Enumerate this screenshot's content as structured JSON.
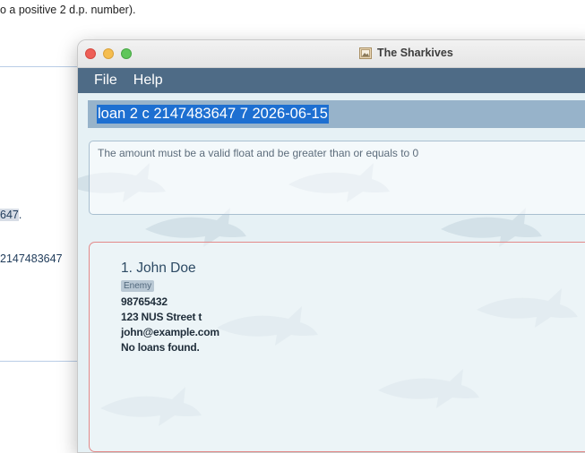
{
  "background_doc": {
    "top_text": "o a positive 2 d.p. number).",
    "fragment_1": "647",
    "fragment_1_suffix": ".",
    "fragment_2": "2147483647"
  },
  "window": {
    "title": "The Sharkives",
    "menu": [
      "File",
      "Help"
    ]
  },
  "command": {
    "value": "loan 2 c 2147483647 7 2026-06-15"
  },
  "result": {
    "message": "The amount must be a valid float and be greater than or equals to 0"
  },
  "person_card": {
    "index_name": "1.  John Doe",
    "tag": "Enemy",
    "phone": "98765432",
    "address": "123 NUS Street t",
    "email": "john@example.com",
    "loans": "No loans found."
  },
  "colors": {
    "menubar": "#4e6b86",
    "command_bg": "#97b3ca",
    "selection": "#1d6fd1",
    "panel_border": "#e38989",
    "content_bg": "#e6f1f5"
  },
  "icons": {
    "title_icon": "image-file-icon",
    "background_decoration": "shark-icon"
  }
}
